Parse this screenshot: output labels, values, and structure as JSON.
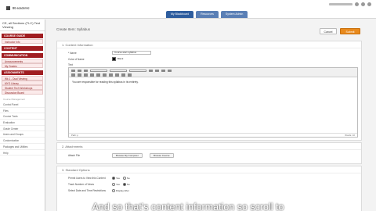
{
  "topbar": {
    "logo_text": "Bb academic",
    "tabs": [
      "My Blackboard",
      "Resources",
      "System Admin"
    ]
  },
  "sidebar": {
    "course_title": "CE, all Sections (TLC) Test Viewing",
    "sections": [
      {
        "heading": "COURSE GUIDE",
        "items": [
          "Instructor Info"
        ]
      },
      {
        "heading": "CONTENT",
        "items": []
      },
      {
        "heading": "COMMUNICATION",
        "items": [
          "Announcements",
          "My Grades"
        ]
      },
      {
        "heading": "ASSIGNMENTS",
        "items": [
          "Wk 1 - Dual Viewing",
          "MYO Library",
          "Student Tech Workshops",
          "Discussion Board"
        ]
      }
    ],
    "mgmt_label": "Course Management",
    "mgmt_items": [
      "Control Panel",
      "Files",
      "Course Tools",
      "Evaluation",
      "Grade Center",
      "Users and Groups",
      "Customization",
      "Packages and Utilities",
      "Help"
    ]
  },
  "main": {
    "page_title": "Create Item: Syllabus",
    "cancel_label": "Cancel",
    "submit_label": "Submit",
    "content_info": {
      "heading": "1.   Content Information",
      "name_label": "* Name",
      "name_value": "Course-start syllabus",
      "color_label": "Color of Name",
      "color_value": "Black",
      "text_label": "Text",
      "editor_text": "You are responsible for reading this syllabus in its entirety.",
      "editor_path": "Path: p",
      "editor_words": "Words: 10"
    },
    "attachments": {
      "heading": "2.   Attachments",
      "attach_label": "Attach File",
      "browse_computer": "Browse My Computer",
      "browse_course": "Browse Course"
    },
    "standard_options": {
      "heading": "3.   Standard Options",
      "rows": [
        {
          "label": "Permit Users to View this Content",
          "yes": "Yes",
          "no": "No"
        },
        {
          "label": "Track Number of Views",
          "yes": "Yes",
          "no": "No"
        },
        {
          "label": "Select Date and Time Restrictions",
          "yes": "Display After",
          "no": ""
        }
      ]
    }
  },
  "subtitle": "And so that's content information so scroll to"
}
